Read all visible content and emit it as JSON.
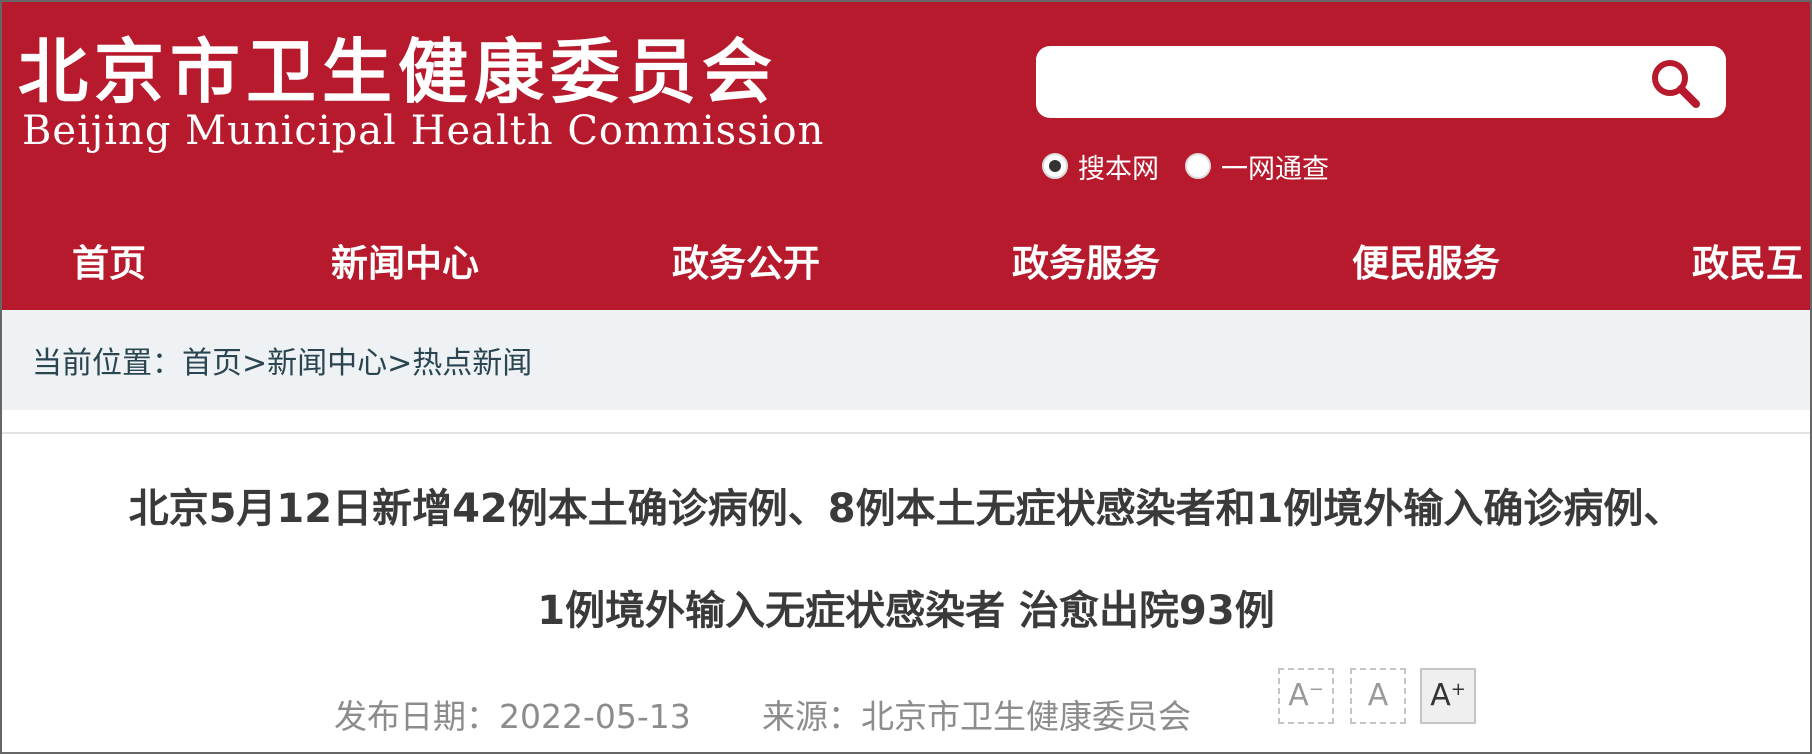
{
  "site": {
    "name_cn": "北京市卫生健康委员会",
    "name_en": "Beijing Municipal Health Commission"
  },
  "search": {
    "value": "",
    "placeholder": "",
    "icon": "search-icon",
    "scope_options": [
      {
        "label": "搜本网",
        "checked": true
      },
      {
        "label": "一网通查",
        "checked": false
      }
    ]
  },
  "nav": {
    "items": [
      "首页",
      "新闻中心",
      "政务公开",
      "政务服务",
      "便民服务",
      "政民互"
    ]
  },
  "breadcrumb": {
    "prefix": "当前位置：",
    "items": [
      "首页",
      "新闻中心",
      "热点新闻"
    ],
    "separator": ">"
  },
  "article": {
    "title_line1": "北京5月12日新增42例本土确诊病例、8例本土无症状感染者和1例境外输入确诊病例、",
    "title_line2": "1例境外输入无症状感染者 治愈出院93例",
    "publish_date": "发布日期：2022-05-13",
    "source": "来源：北京市卫生健康委员会"
  },
  "font_size_controls": {
    "decrease": "A",
    "decrease_mark": "−",
    "normal": "A",
    "increase": "A",
    "increase_mark": "+"
  },
  "colors": {
    "brand_red": "#b61a2c",
    "breadcrumb_bg": "#eef2f5",
    "title_text": "#3a3a3a",
    "meta_text": "#8c8c8c"
  }
}
